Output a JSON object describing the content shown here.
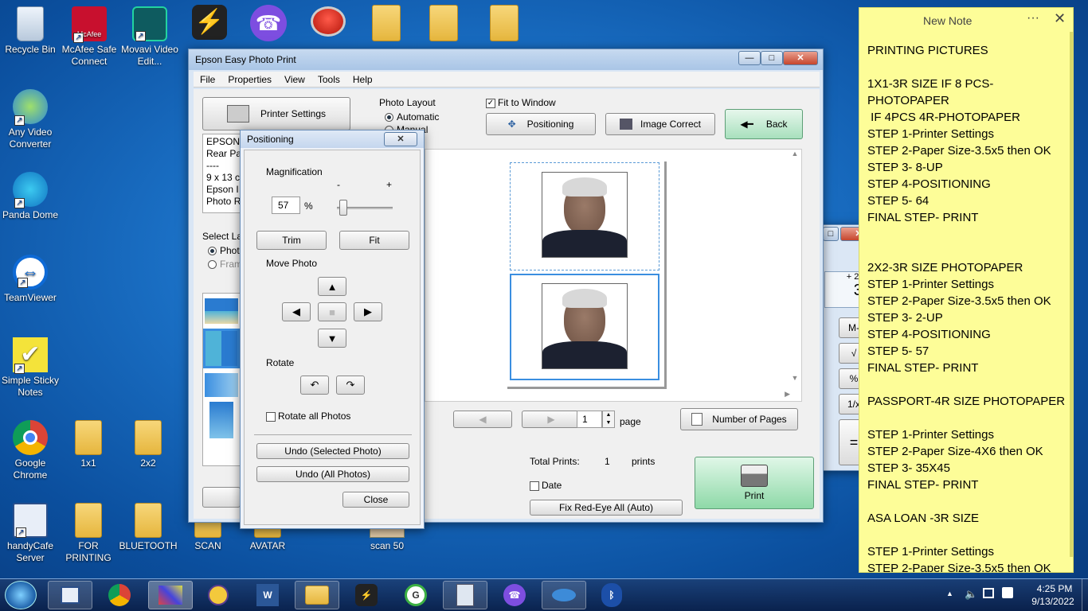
{
  "desktop_icons": [
    {
      "label": "Recycle Bin",
      "icon": "recycle-bin-icon"
    },
    {
      "label": "McAfee Safe Connect",
      "icon": "mcafee-icon"
    },
    {
      "label": "Movavi Video Edit...",
      "icon": "movavi-icon"
    },
    {
      "label": "Any Video Converter",
      "icon": "video-converter-icon"
    },
    {
      "label": "Panda Dome",
      "icon": "panda-icon"
    },
    {
      "label": "TeamViewer",
      "icon": "teamviewer-icon"
    },
    {
      "label": "Simple Sticky Notes",
      "icon": "sticky-notes-icon"
    },
    {
      "label": "Google Chrome",
      "icon": "chrome-icon"
    },
    {
      "label": "1x1",
      "icon": "folder-icon"
    },
    {
      "label": "2x2",
      "icon": "folder-icon"
    },
    {
      "label": "handyCafe Server",
      "icon": "handycafe-icon"
    },
    {
      "label": "FOR PRINTING",
      "icon": "folder-icon"
    },
    {
      "label": "BLUETOOTH",
      "icon": "folder-icon"
    },
    {
      "label": "SCAN",
      "icon": "folder-icon"
    },
    {
      "label": "AVATAR",
      "icon": "folder-icon"
    },
    {
      "label": "scan 50",
      "icon": "image-icon"
    }
  ],
  "epson": {
    "title": "Epson Easy Photo Print",
    "menu": [
      "File",
      "Properties",
      "View",
      "Tools",
      "Help"
    ],
    "printer_settings": "Printer Settings",
    "info_lines": [
      "EPSON",
      "Rear Pa",
      "----",
      "9 x 13 c",
      "Epson I",
      "Photo R"
    ],
    "select_layout": "Select La",
    "layout_photo": "Photo",
    "layout_frame": "Fram",
    "photo_layout_label": "Photo Layout",
    "automatic": "Automatic",
    "manual": "Manual",
    "fit_to_window": "Fit to Window",
    "positioning": "Positioning",
    "image_correct": "Image Correct",
    "back": "Back",
    "page_value": "1",
    "page_label": "page",
    "number_of_pages": "Number of Pages",
    "total_prints_label": "Total Prints:",
    "total_prints_value": "1",
    "prints_label": "prints",
    "date": "Date",
    "fix_red_eye": "Fix Red-Eye All (Auto)",
    "print": "Print"
  },
  "positioning": {
    "title": "Positioning",
    "magnification": "Magnification",
    "minus": "-",
    "plus": "+",
    "value": "57",
    "percent": "%",
    "slider_fraction": 0.05,
    "trim": "Trim",
    "fit": "Fit",
    "move_photo": "Move Photo",
    "rotate": "Rotate",
    "rotate_all": "Rotate all Photos",
    "undo_selected": "Undo (Selected Photo)",
    "undo_all": "Undo (All Photos)",
    "close": "Close"
  },
  "calculator": {
    "mem": "+ 25 +",
    "display": "37",
    "keys": [
      "M-",
      "√",
      "%",
      "1/x",
      "="
    ]
  },
  "sticky": {
    "title": "New Note",
    "lines": [
      "PRINTING PICTURES",
      "",
      "1X1-3R SIZE IF 8 PCS-",
      "PHOTOPAPER",
      " IF 4PCS 4R-PHOTOPAPER",
      "STEP 1-Printer Settings",
      "STEP 2-Paper Size-3.5x5 then OK",
      "STEP 3- 8-UP",
      "STEP 4-POSITIONING",
      "STEP 5- 64",
      "FINAL STEP- PRINT",
      "",
      "",
      "2X2-3R SIZE PHOTOPAPER",
      "STEP 1-Printer Settings",
      "STEP 2-Paper Size-3.5x5 then OK",
      "STEP 3- 2-UP",
      "STEP 4-POSITIONING",
      "STEP 5- 57",
      "FINAL STEP- PRINT",
      "",
      "PASSPORT-4R SIZE PHOTOPAPER",
      "",
      "STEP 1-Printer Settings",
      "STEP 2-Paper Size-4X6 then OK",
      "STEP 3- 35X45",
      "FINAL STEP- PRINT",
      "",
      "ASA LOAN -3R SIZE",
      "",
      "STEP 1-Printer Settings",
      "STEP 2-Paper Size-3.5x5 then OK"
    ]
  },
  "taskbar": {
    "time": "4:25 PM",
    "date": "9/13/2022"
  }
}
